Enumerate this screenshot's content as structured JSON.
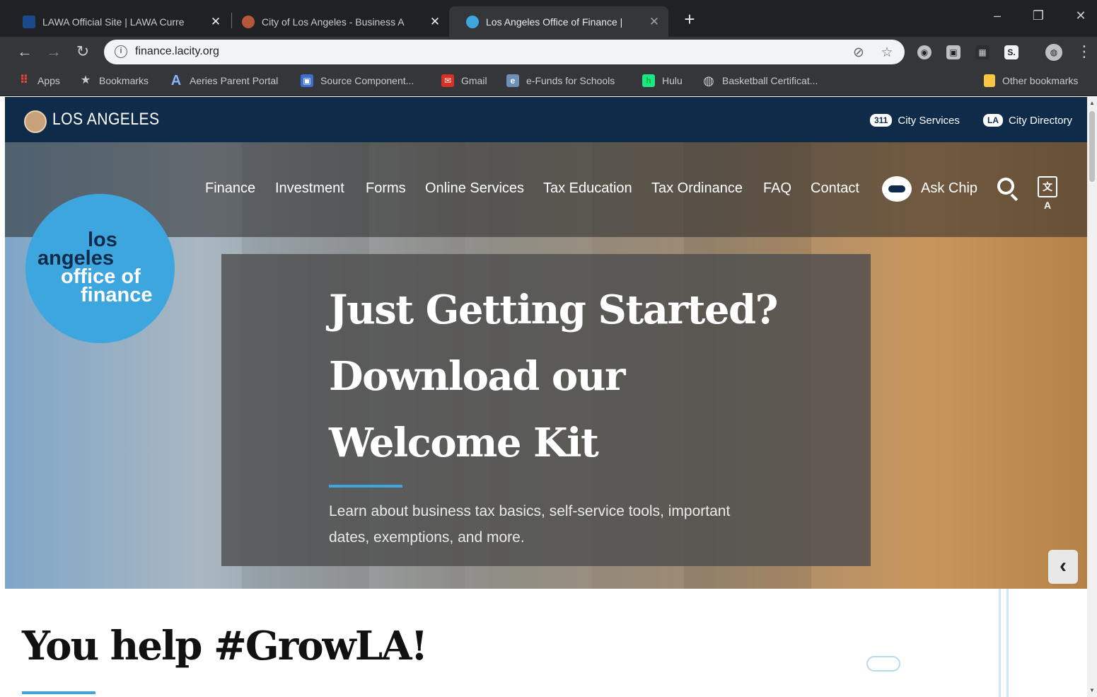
{
  "browser": {
    "tabs": [
      {
        "title": "LAWA Official Site | LAWA Curre",
        "favicon_color": "#1a4a8a",
        "close": "✕"
      },
      {
        "title": "City of Los Angeles - Business A",
        "favicon_color": "#b5573b",
        "close": "✕"
      },
      {
        "title": "Los Angeles Office of Finance |",
        "favicon_color": "#3ea6df",
        "close": "✕"
      }
    ],
    "new_tab": "+",
    "window_controls": {
      "minimize": "–",
      "restore": "❐",
      "close": "✕"
    },
    "nav": {
      "back": "←",
      "forward": "→",
      "reload": "↻"
    },
    "address": {
      "info_glyph": "i",
      "url": "finance.lacity.org"
    },
    "omnibox_icons": {
      "blocked": "⊘",
      "star": "☆"
    },
    "extensions": [
      "◉",
      "▣",
      "▦",
      "S."
    ],
    "profile": "◍",
    "menu": "⋮",
    "bookmarks": [
      {
        "label": "Apps",
        "icon": "apps-grid-icon",
        "glyph": "⠿",
        "color": "#e8453c"
      },
      {
        "label": "Bookmarks",
        "icon": "star-icon",
        "glyph": "★",
        "color": "#35363a"
      },
      {
        "label": "Aeries Parent Portal",
        "icon": "aeries-icon",
        "glyph": "A",
        "color": "#1a73e8"
      },
      {
        "label": "Source Component...",
        "icon": "source-icon",
        "glyph": "▣",
        "color": "#3b6fd1"
      },
      {
        "label": "Gmail",
        "icon": "gmail-icon",
        "glyph": "✉",
        "color": "#d93025"
      },
      {
        "label": "e-Funds for Schools",
        "icon": "efunds-icon",
        "glyph": "e",
        "color": "#6f8fb5"
      },
      {
        "label": "Hulu",
        "icon": "hulu-icon",
        "glyph": "h",
        "color": "#1ce783"
      },
      {
        "label": "Basketball Certificat...",
        "icon": "globe-icon",
        "glyph": "◍",
        "color": "#5f6368"
      }
    ],
    "other_bookmarks": {
      "label": "Other bookmarks",
      "color": "#f9c642"
    }
  },
  "la_bar": {
    "title": "LOS ANGELES",
    "links": [
      {
        "badge": "311",
        "label": "City Services"
      },
      {
        "badge": "LA",
        "label": "City Directory"
      }
    ]
  },
  "logo": {
    "lines": [
      "los",
      "angeles",
      "office of",
      "finance"
    ],
    "color": "#3ea6df"
  },
  "nav": {
    "items": [
      "Finance",
      "Investment",
      "Forms",
      "Online Services",
      "Tax Education",
      "Tax Ordinance",
      "FAQ",
      "Contact"
    ],
    "ask_chip": "Ask Chip",
    "translate_glyph": "文A"
  },
  "promo": {
    "headline": "Just Getting Started? Download our Welcome Kit",
    "body": "Learn about business tax basics, self-service tools, important dates, exemptions, and more."
  },
  "carousel": {
    "prev": "‹",
    "next": "›"
  },
  "section": {
    "title": "You help #GrowLA!"
  },
  "colors": {
    "accent": "#3ea6df",
    "la_navy": "#0f2b4a"
  }
}
